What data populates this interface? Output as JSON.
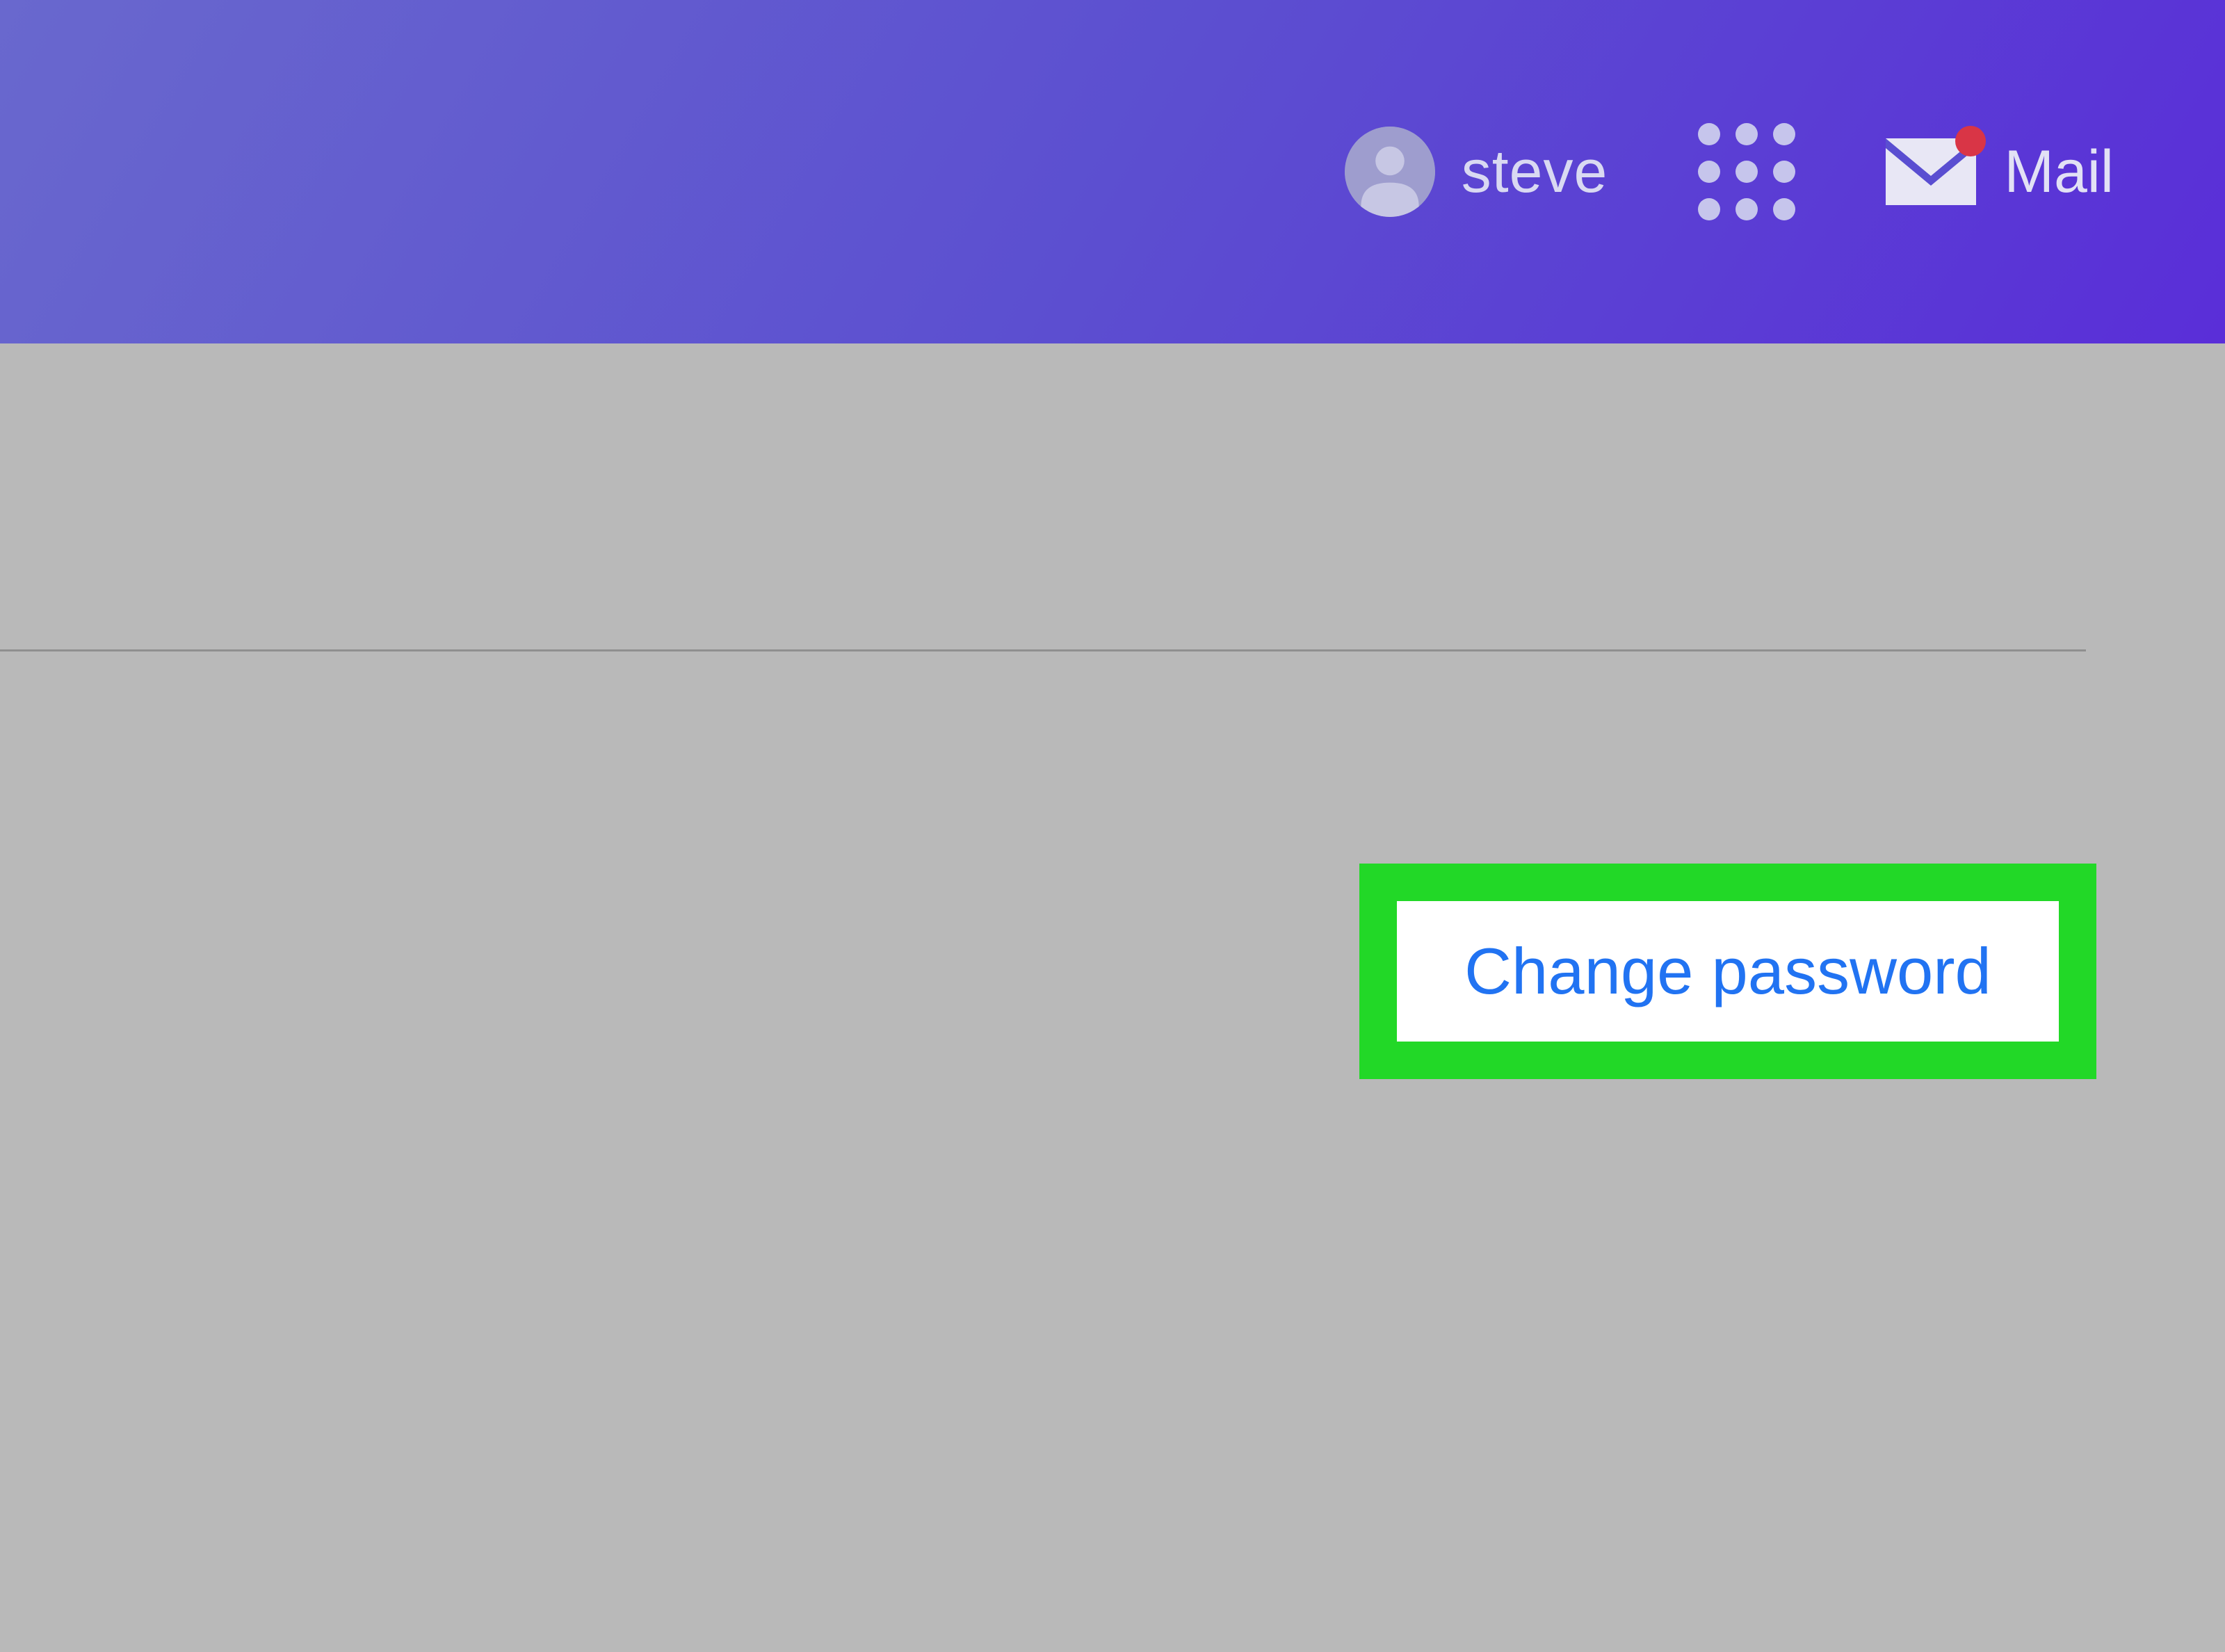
{
  "header": {
    "username": "steve",
    "mail_label": "Mail"
  },
  "main": {
    "change_password_label": "Change password"
  },
  "colors": {
    "header_gradient_start": "#6968ce",
    "header_gradient_end": "#5a2ed8",
    "body_bg": "#b9b9b9",
    "highlight_border": "#22d827",
    "link_color": "#2173f2",
    "notify_badge": "#d93546"
  }
}
